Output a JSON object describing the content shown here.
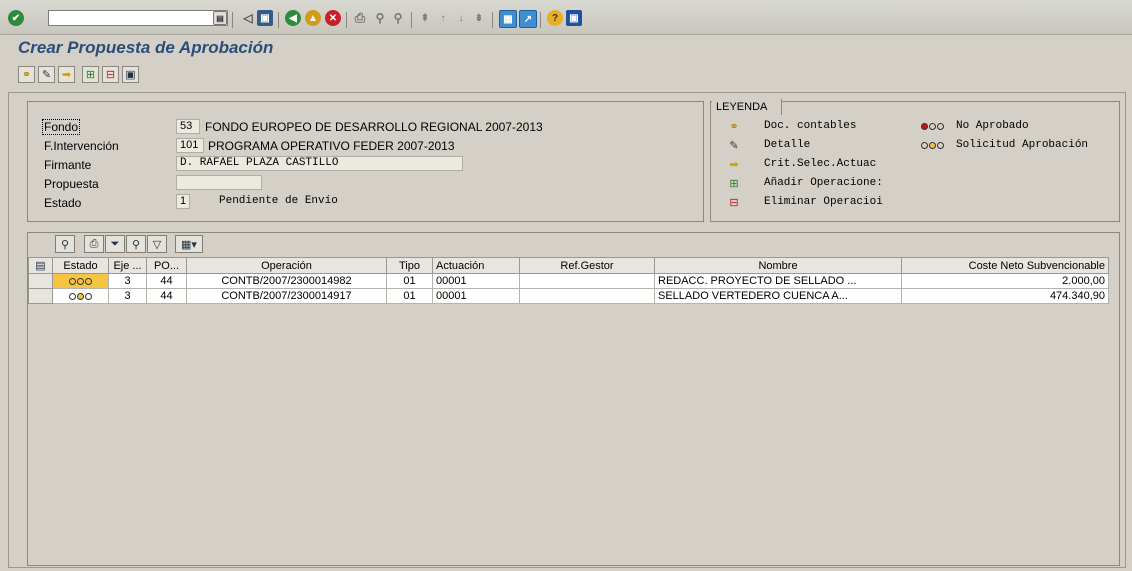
{
  "colors": {
    "title": "#2a4d7a",
    "status_yellow": "#f5c542",
    "light_red": "#d01010",
    "light_green": "#1c8a2a"
  },
  "systembar": {
    "icons": [
      "enter-icon",
      "save-icon",
      "back-icon",
      "exit-icon",
      "cancel-icon",
      "print-icon",
      "find-icon",
      "find-next-icon",
      "first-page-icon",
      "previous-page-icon",
      "next-page-icon",
      "last-page-icon",
      "create-session-icon",
      "shortcut-icon",
      "help-icon",
      "customize-layout-icon"
    ],
    "command_field_value": ""
  },
  "page": {
    "title": "Crear Propuesta de Aprobación"
  },
  "apptoolbar": {
    "icons": [
      "documents-icon",
      "detail-icon",
      "selection-criteria-icon",
      "add-operations-icon",
      "delete-operations-icon",
      "save-layout-icon"
    ]
  },
  "header": {
    "fondo_label": "Fondo",
    "fondo_code": "53",
    "fondo_text": "FONDO EUROPEO DE DESARROLLO REGIONAL 2007-2013",
    "intervencion_label": "F.Intervención",
    "intervencion_code": "101",
    "intervencion_text": "PROGRAMA OPERATIVO FEDER 2007-2013",
    "firmante_label": "Firmante",
    "firmante_value": "D. RAFAEL PLAZA CASTILLO",
    "propuesta_label": "Propuesta",
    "propuesta_value": "",
    "estado_label": "Estado",
    "estado_code": "1",
    "estado_text": "Pendiente de Envío"
  },
  "legend": {
    "title": "LEYENDA",
    "items": [
      {
        "icon": "documents-icon",
        "text": "Doc. contables"
      },
      {
        "icon": "detail-icon",
        "text": "Detalle"
      },
      {
        "icon": "selection-criteria-icon",
        "text": "Crit.Selec.Actuac"
      },
      {
        "icon": "add-operations-icon",
        "text": "Añadir Operacione:"
      },
      {
        "icon": "delete-operations-icon",
        "text": "Eliminar Operacioi"
      }
    ],
    "status_items": [
      {
        "icon": "red-light-icon",
        "text": "No Aprobado"
      },
      {
        "icon": "yellow-light-icon",
        "text": "Solicitud Aprobación"
      }
    ]
  },
  "grid": {
    "toolbar_icons": [
      "details-icon",
      "print-icon",
      "filter-icon",
      "find-icon",
      "set-filter-icon",
      "export-icon"
    ],
    "columns": [
      "Estado",
      "Eje ...",
      "PO...",
      "Operación",
      "Tipo",
      "Actuación",
      "Ref.Gestor",
      "Nombre",
      "Coste Neto Subvencionable"
    ],
    "rows": [
      {
        "eje": "3",
        "po": "44",
        "operacion": "CONTB/2007/2300014982",
        "tipo": "01",
        "actuacion": "00001",
        "ref_gestor": "",
        "nombre": "REDACC. PROYECTO DE SELLADO ...",
        "coste": "2.000,00"
      },
      {
        "eje": "3",
        "po": "44",
        "operacion": "CONTB/2007/2300014917",
        "tipo": "01",
        "actuacion": "00001",
        "ref_gestor": "",
        "nombre": "SELLADO VERTEDERO CUENCA A...",
        "coste": "474.340,90"
      }
    ]
  }
}
